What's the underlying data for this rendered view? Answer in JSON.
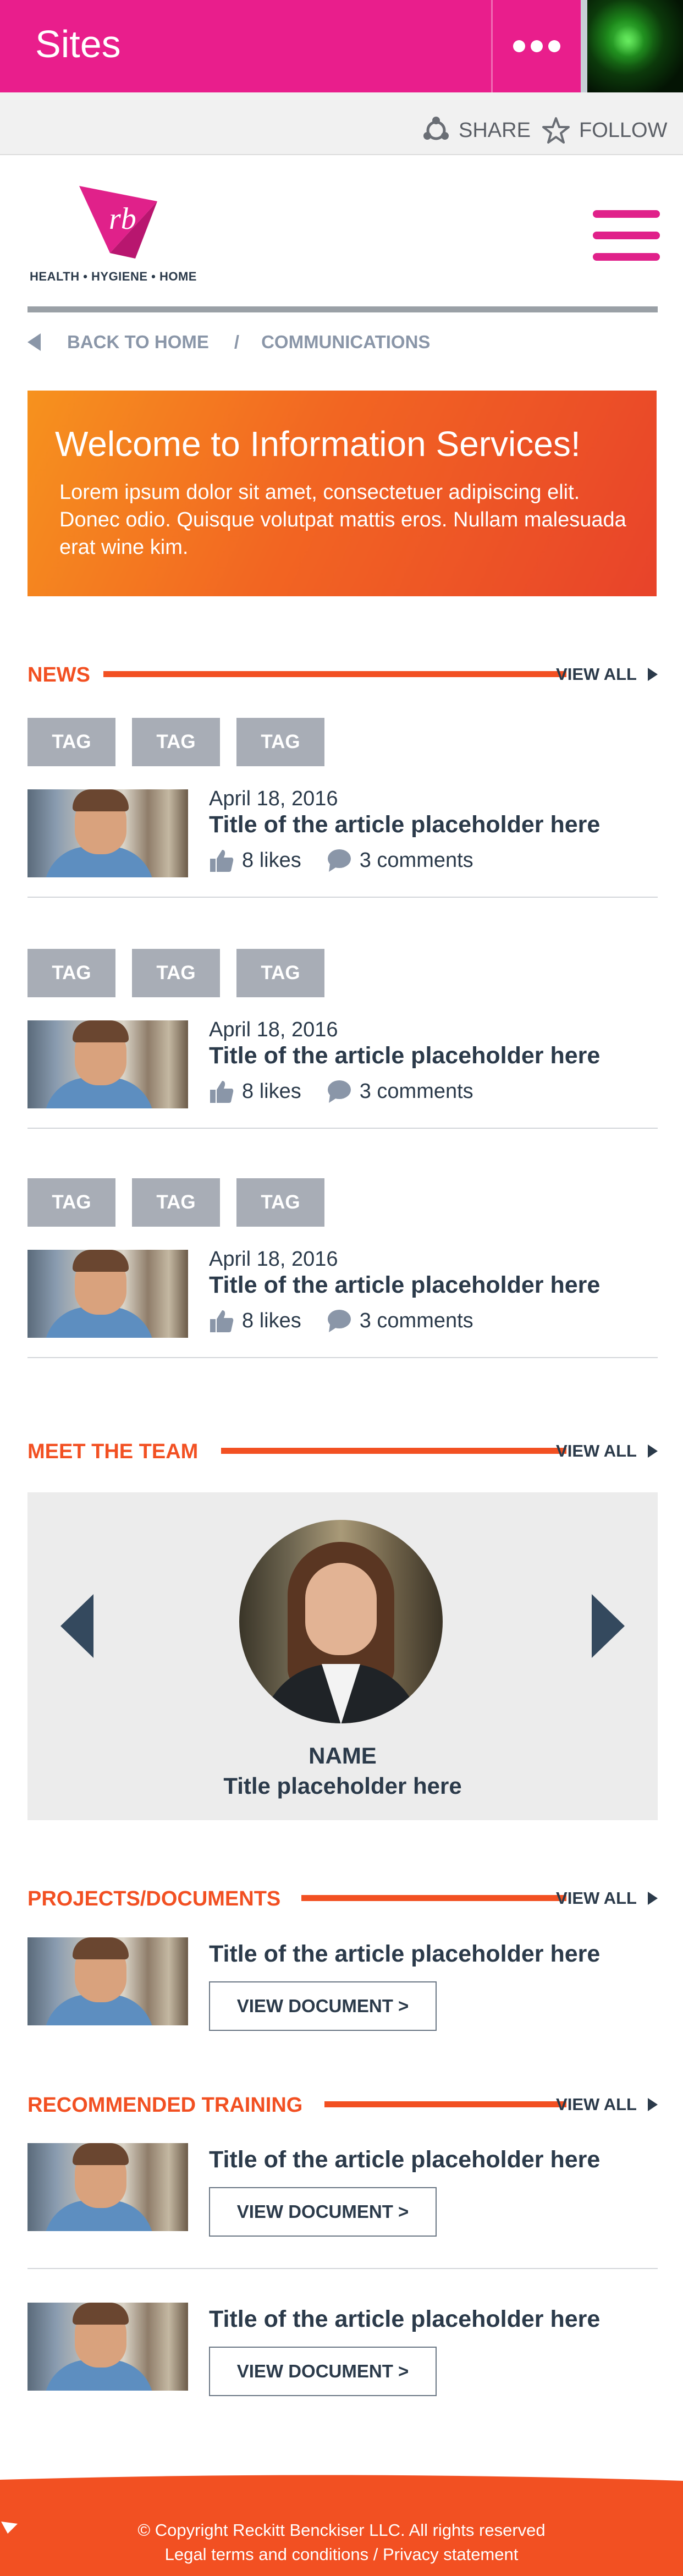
{
  "suite_bar": {
    "title": "Sites",
    "more_icon": "ellipsis-icon",
    "avatar_icon": "user-avatar"
  },
  "actions": {
    "share_label": "SHARE",
    "follow_label": "FOLLOW"
  },
  "brand": {
    "logo_text": "HEALTH • HYGIENE • HOME",
    "logo_mark": "rb",
    "primary_color": "#e0218a"
  },
  "breadcrumb": {
    "back": "BACK TO HOME",
    "separator": "/",
    "current": "COMMUNICATIONS"
  },
  "hero": {
    "title": "Welcome to Information Services!",
    "body": "Lorem ipsum dolor sit amet, consectetuer adipiscing elit. Donec odio. Quisque volutpat mattis eros. Nullam malesuada erat wine kim."
  },
  "news": {
    "heading": "NEWS",
    "view_all": "VIEW ALL",
    "items": [
      {
        "tags": [
          "TAG",
          "TAG",
          "TAG"
        ],
        "date": "April 18, 2016",
        "title": "Title of the article placeholder here",
        "likes": "8 likes",
        "comments": "3 comments"
      },
      {
        "tags": [
          "TAG",
          "TAG",
          "TAG"
        ],
        "date": "April 18, 2016",
        "title": "Title of the article placeholder here",
        "likes": "8 likes",
        "comments": "3 comments"
      },
      {
        "tags": [
          "TAG",
          "TAG",
          "TAG"
        ],
        "date": "April 18, 2016",
        "title": "Title of the article placeholder here",
        "likes": "8 likes",
        "comments": "3 comments"
      }
    ]
  },
  "team": {
    "heading": "MEET THE TEAM",
    "view_all": "VIEW ALL",
    "member": {
      "name": "NAME",
      "role": "Title placeholder here"
    }
  },
  "projects": {
    "heading": "PROJECTS/DOCUMENTS",
    "view_all": "VIEW ALL",
    "items": [
      {
        "title": "Title of the article placeholder here",
        "button": "VIEW DOCUMENT >"
      }
    ]
  },
  "training": {
    "heading": "RECOMMENDED TRAINING",
    "view_all": "VIEW ALL",
    "items": [
      {
        "title": "Title of the article placeholder here",
        "button": "VIEW DOCUMENT >"
      },
      {
        "title": "Title of the article placeholder here",
        "button": "VIEW DOCUMENT >"
      }
    ]
  },
  "footer": {
    "copyright": "© Copyright Reckitt Benckiser LLC. All rights reserved",
    "links": "Legal terms and conditions / Privacy statement",
    "background_color": "#f25022"
  }
}
